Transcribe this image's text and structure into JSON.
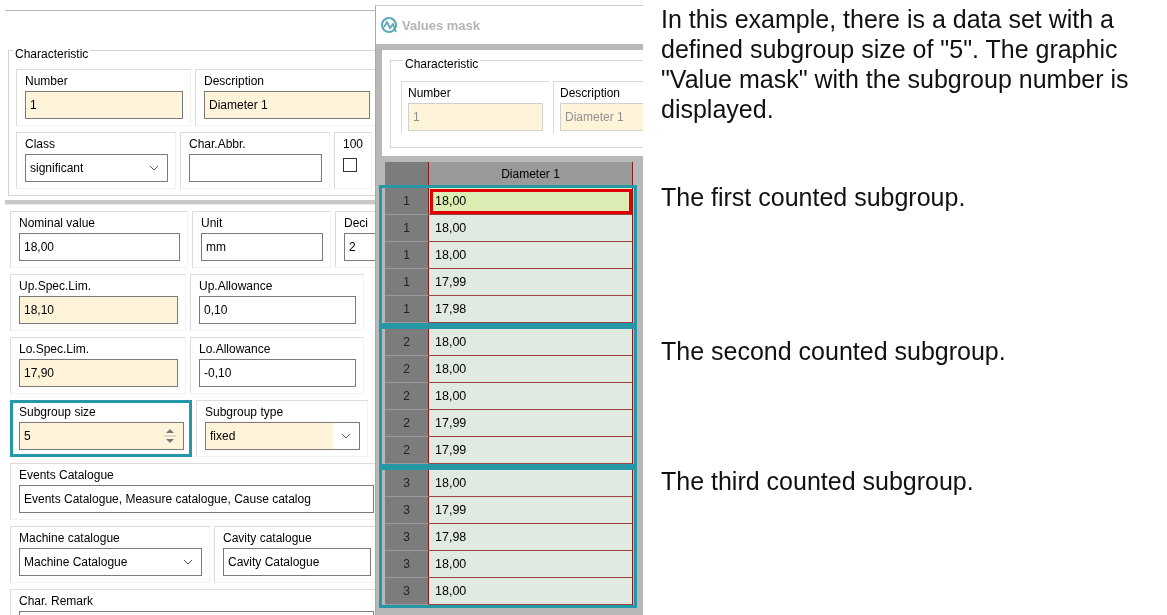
{
  "form": {
    "sections": [
      {
        "title": "Characteristic",
        "rows": [
          [
            {
              "kind": "text",
              "label": "Number",
              "value": "1",
              "mandatory": true,
              "highlighted": false
            },
            {
              "kind": "text",
              "label": "Description",
              "value": "Diameter 1",
              "mandatory": true,
              "highlighted": false
            }
          ],
          [
            {
              "kind": "combo",
              "label": "Class",
              "value": "significant",
              "mandatory": false,
              "highlighted": false
            },
            {
              "kind": "text",
              "label": "Char.Abbr.",
              "mandatory": false,
              "highlighted": false
            },
            {
              "kind": "checkbox",
              "label": "100",
              "checked": false,
              "highlighted": false
            }
          ]
        ]
      },
      {
        "rows": [
          [
            {
              "kind": "text",
              "label": "Nominal value",
              "value": "18,00",
              "mandatory": false,
              "highlighted": false
            },
            {
              "kind": "text",
              "label": "Unit",
              "value": "mm",
              "mandatory": false,
              "highlighted": false
            },
            {
              "kind": "text",
              "label": "Deci",
              "value": "2",
              "mandatory": false,
              "highlighted": false
            }
          ],
          [
            {
              "kind": "text",
              "label": "Up.Spec.Lim.",
              "value": "18,10",
              "mandatory": true,
              "highlighted": false
            },
            {
              "kind": "text",
              "label": "Up.Allowance",
              "value": "0,10",
              "mandatory": false,
              "highlighted": false
            }
          ],
          [
            {
              "kind": "text",
              "label": "Lo.Spec.Lim.",
              "value": "17,90",
              "mandatory": true,
              "highlighted": false
            },
            {
              "kind": "text",
              "label": "Lo.Allowance",
              "value": "-0,10",
              "mandatory": false,
              "highlighted": false
            }
          ],
          [
            {
              "kind": "spin",
              "label": "Subgroup size",
              "value": "5",
              "mandatory": true,
              "highlighted": true
            },
            {
              "kind": "combo",
              "label": "Subgroup type",
              "value": "fixed",
              "mandatory": true,
              "highlighted": false
            }
          ],
          [
            {
              "kind": "text",
              "label": "Events Catalogue",
              "value": "Events Catalogue, Measure catalogue, Cause catalog",
              "mandatory": false,
              "highlighted": false
            }
          ],
          [
            {
              "kind": "combo",
              "label": "Machine catalogue",
              "value": "Machine Catalogue",
              "mandatory": false,
              "highlighted": false
            },
            {
              "kind": "text",
              "label": "Cavity catalogue",
              "value": "Cavity Catalogue",
              "mandatory": false,
              "highlighted": false
            }
          ],
          [
            {
              "kind": "memo",
              "label": "Char. Remark",
              "mandatory": false,
              "highlighted": false
            }
          ]
        ]
      }
    ]
  },
  "window": {
    "title": "Values mask",
    "group_title": "Characteristic",
    "fields": [
      {
        "label": "Number",
        "value": "1"
      },
      {
        "label": "Description",
        "value": "Diameter 1"
      }
    ],
    "grid": {
      "columns": [
        "Diameter 1"
      ],
      "subgroups": [
        {
          "framed": true,
          "rows": [
            {
              "number": "1",
              "value": "18,00",
              "selected": true
            },
            {
              "number": "1",
              "value": "18,00",
              "selected": false
            },
            {
              "number": "1",
              "value": "18,00",
              "selected": false
            },
            {
              "number": "1",
              "value": "17,99",
              "selected": false
            },
            {
              "number": "1",
              "value": "17,98",
              "selected": false
            }
          ]
        },
        {
          "framed": true,
          "rows": [
            {
              "number": "2",
              "value": "18,00",
              "selected": false
            },
            {
              "number": "2",
              "value": "18,00",
              "selected": false
            },
            {
              "number": "2",
              "value": "18,00",
              "selected": false
            },
            {
              "number": "2",
              "value": "17,99",
              "selected": false
            },
            {
              "number": "2",
              "value": "17,99",
              "selected": false
            }
          ]
        },
        {
          "framed": true,
          "rows": [
            {
              "number": "3",
              "value": "18,00",
              "selected": false
            },
            {
              "number": "3",
              "value": "17,99",
              "selected": false
            },
            {
              "number": "3",
              "value": "17,98",
              "selected": false
            },
            {
              "number": "3",
              "value": "18,00",
              "selected": false
            },
            {
              "number": "3",
              "value": "18,00",
              "selected": false
            }
          ]
        }
      ]
    }
  },
  "explanation": {
    "intro": "In this example, there is a data set with a defined subgroup size of \"5\". The graphic \"Value mask\" with the subgroup number is displayed.",
    "notes": [
      "The first counted subgroup.",
      "The second counted subgroup.",
      "The third counted subgroup."
    ]
  }
}
